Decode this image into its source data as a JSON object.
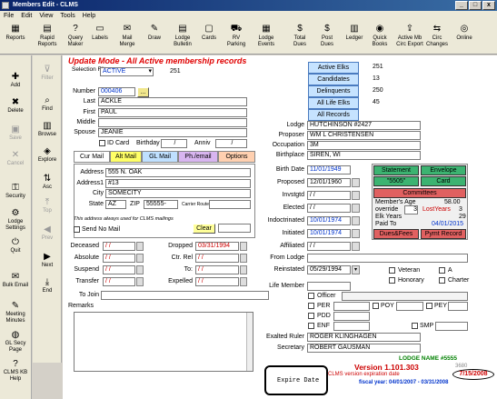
{
  "window": {
    "title": "Members Edit - CLMS",
    "minimize": "_",
    "maximize": "□",
    "close": "x"
  },
  "menu": [
    "File",
    "Edit",
    "View",
    "Tools",
    "Help"
  ],
  "toolbar": [
    {
      "label": "Reports",
      "icon": "reports-icon",
      "glyph": "▦"
    },
    {
      "label": "Rapid Reports",
      "icon": "rapid-reports-icon",
      "glyph": "▤"
    },
    {
      "label": "Query Maker",
      "icon": "query-maker-icon",
      "glyph": "?"
    },
    {
      "label": "Labels",
      "icon": "labels-icon",
      "glyph": "▭"
    },
    {
      "label": "Mail Merge",
      "icon": "mail-merge-icon",
      "glyph": "✉"
    },
    {
      "label": "Draw",
      "icon": "draw-icon",
      "glyph": "✎"
    },
    {
      "label": "Lodge Bulletin",
      "icon": "lodge-bulletin-icon",
      "glyph": "▤"
    },
    {
      "label": "Cards",
      "icon": "cards-icon",
      "glyph": "▢"
    },
    {
      "label": "RV Parking",
      "icon": "rv-parking-icon",
      "glyph": "⛟"
    },
    {
      "label": "Lodge Events",
      "icon": "lodge-events-icon",
      "glyph": "▦"
    },
    {
      "label": "Total Dues",
      "icon": "total-dues-icon",
      "glyph": "$"
    },
    {
      "label": "Post Dues",
      "icon": "post-dues-icon",
      "glyph": "$"
    },
    {
      "label": "Ledger",
      "icon": "ledger-icon",
      "glyph": "▥"
    },
    {
      "label": "Quick Books",
      "icon": "quick-books-icon",
      "glyph": "◉"
    },
    {
      "label": "Active Mb Circ Export",
      "icon": "export-icon",
      "glyph": "⇪"
    },
    {
      "label": "Circ Changes",
      "icon": "circ-changes-icon",
      "glyph": "⇆"
    },
    {
      "label": "Online",
      "icon": "online-icon",
      "glyph": "◎"
    }
  ],
  "sidebar": [
    {
      "label": "Add",
      "icon": "add-icon",
      "glyph": "✚",
      "enabled": true
    },
    {
      "label": "Delete",
      "icon": "delete-icon",
      "glyph": "✖",
      "enabled": true
    },
    {
      "label": "Save",
      "icon": "save-icon",
      "glyph": "▣",
      "enabled": false
    },
    {
      "label": "Cancel",
      "icon": "cancel-icon",
      "glyph": "✕",
      "enabled": false
    },
    {
      "label": "Security",
      "icon": "security-icon",
      "glyph": "⚿",
      "enabled": true
    },
    {
      "label": "Lodge Settings",
      "icon": "lodge-settings-icon",
      "glyph": "⚙",
      "enabled": true
    },
    {
      "label": "Quit",
      "icon": "quit-icon",
      "glyph": "⏻",
      "enabled": true
    },
    {
      "label": "Bulk Email",
      "icon": "bulk-email-icon",
      "glyph": "✉",
      "enabled": true
    },
    {
      "label": "Meeting Minutes",
      "icon": "meeting-minutes-icon",
      "glyph": "✎",
      "enabled": true
    },
    {
      "label": "GL Secy Page",
      "icon": "gl-secy-page-icon",
      "glyph": "◍",
      "enabled": true
    },
    {
      "label": "CLMS KB Help",
      "icon": "kb-help-icon",
      "glyph": "?",
      "enabled": true
    }
  ],
  "sidebar2": [
    {
      "label": "Filter",
      "icon": "filter-icon",
      "glyph": "⊽",
      "enabled": false
    },
    {
      "label": "Find",
      "icon": "find-icon",
      "glyph": "⌕",
      "enabled": true
    },
    {
      "label": "Browse",
      "icon": "browse-icon",
      "glyph": "▥",
      "enabled": true
    },
    {
      "label": "Explore",
      "icon": "explore-icon",
      "glyph": "◈",
      "enabled": true
    },
    {
      "label": "Asc",
      "icon": "asc-icon",
      "glyph": "⇅",
      "enabled": true
    },
    {
      "label": "Top",
      "icon": "top-icon",
      "glyph": "⤒",
      "enabled": false
    },
    {
      "label": "Prev",
      "icon": "prev-icon",
      "glyph": "◀",
      "enabled": false
    },
    {
      "label": "Next",
      "icon": "next-icon",
      "glyph": "▶",
      "enabled": true
    },
    {
      "label": "End",
      "icon": "end-icon",
      "glyph": "⤓",
      "enabled": true
    }
  ],
  "header": {
    "mode": "Update Mode - All Active membership records"
  },
  "selection": {
    "label": "Selection Filter",
    "value": "ACTIVE",
    "count": "251"
  },
  "stats": [
    {
      "label": "Active Elks",
      "value": "251"
    },
    {
      "label": "Candidates",
      "value": "13"
    },
    {
      "label": "Delinquents",
      "value": "250"
    },
    {
      "label": "All Life Elks",
      "value": "45"
    },
    {
      "label": "All Records",
      "value": ""
    }
  ],
  "member": {
    "number_label": "Number",
    "number": "000406",
    "lookup": "...",
    "last_label": "Last",
    "last": "ACKLE",
    "first_label": "First",
    "first": "PAUL",
    "middle_label": "Middle",
    "middle": "",
    "spouse_label": "Spouse",
    "spouse": "JEANIE",
    "idcard_label": "ID Card",
    "birthday_label": "Birthday",
    "birthday": "/",
    "anniv_label": "Anniv",
    "anniv": "/"
  },
  "tabs": [
    "Cur Mail",
    "Alt Mail",
    "GL Mail",
    "Ph./email",
    "Options"
  ],
  "address": {
    "address_label": "Address",
    "address": "555 N. OAK",
    "address1_label": "Address1",
    "address1": "#13",
    "city_label": "City",
    "city": "SOMECITY",
    "state_label": "State",
    "state": "AZ",
    "zip_label": "ZIP",
    "zip": "55555-",
    "carrier_label": "Carrier Route",
    "note": "This address always used for CLMS mailings",
    "sendnomail_label": "Send No Mail",
    "clear_label": "Clear"
  },
  "status_dates": [
    {
      "label": "Deceased",
      "value": "/ /"
    },
    {
      "label": "Absolute",
      "value": "/ /"
    },
    {
      "label": "Suspend",
      "value": "/ /"
    },
    {
      "label": "Transfer",
      "value": "/ /"
    }
  ],
  "status_dates2": [
    {
      "label": "Dropped",
      "value": "03/31/1994"
    },
    {
      "label": "Ctr. Rel",
      "value": "/ /"
    },
    {
      "label": "To:",
      "value": "/ /"
    },
    {
      "label": "Expelled",
      "value": "/ /"
    }
  ],
  "tojoin_label": "To Join",
  "remarks_label": "Remarks",
  "lodge": {
    "lodge_label": "Lodge",
    "lodge": "HUTCHINSON #2427",
    "proposer_label": "Proposer",
    "proposer": "WM L CHRISTENSEN",
    "occupation_label": "Occupation",
    "occupation": "3M",
    "birthplace_label": "Birthplace",
    "birthplace": "SIREN, WI"
  },
  "dates": [
    {
      "label": "Birth Date",
      "value": "11/01/1949"
    },
    {
      "label": "Proposed",
      "value": "12/01/1960"
    },
    {
      "label": "Invstgtd",
      "value": "/ /"
    },
    {
      "label": "Elected",
      "value": "/ /"
    },
    {
      "label": "Indoctrinated",
      "value": "10/01/1974"
    },
    {
      "label": "Initiated",
      "value": "10/01/1974"
    },
    {
      "label": "Affiliated",
      "value": "/ /"
    }
  ],
  "panel": {
    "statement": "Statement",
    "envelope": "Envelope",
    "code": "\"5505\"",
    "card": "Card",
    "committees": "Committees",
    "members_age_label": "Member's Age",
    "members_age": "58.00",
    "override_label": "override",
    "override": "3",
    "lostyears_label": "LostYears",
    "lostyears": "3",
    "elkyears_label": "Elk Years",
    "elkyears": "29",
    "paidto_label": "Paid To",
    "paidto": "04/01/2015",
    "duesfees": "Dues&Fees",
    "pymtrecord": "Pymt Record"
  },
  "from_lodge_label": "From Lodge",
  "reinstated_label": "Reinstated",
  "reinstated": "05/29/1994",
  "veteran_label": "Veteran",
  "a_label": "A",
  "honorary_label": "Honorary",
  "charter_label": "Charter",
  "lifemember_label": "Life Member",
  "officer_label": "Officer",
  "per_label": "PER",
  "poy_label": "POY",
  "pey_label": "PEY",
  "pdd_label": "PDD",
  "enf_label": "ENF",
  "smp_label": "SMP",
  "exalted_label": "Exalted Ruler",
  "exalted": "ROGER KLINGHAGEN",
  "secretary_label": "Secretary",
  "secretary": "ROBERT GAUSMAN",
  "footer": {
    "lodge_name": "LODGE NAME #5555",
    "version": "Version 1.101.303",
    "version_suffix": "3680",
    "expiration_label": "CLMS version expiration date",
    "expiration": "7/15/2008",
    "fiscal": "fiscal year: 04/01/2007 - 03/31/2008",
    "expire_box": "Expire Date"
  }
}
